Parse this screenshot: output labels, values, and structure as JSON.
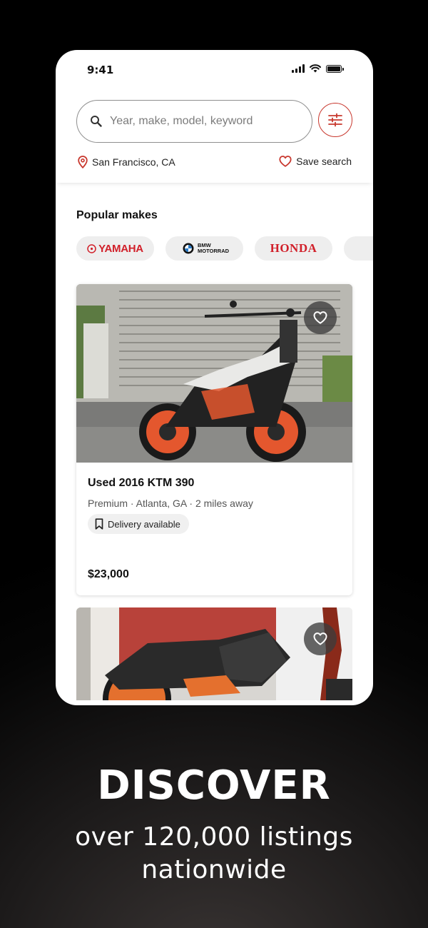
{
  "status_bar": {
    "time": "9:41"
  },
  "search": {
    "placeholder": "Year, make, model, keyword"
  },
  "location": {
    "label": "San Francisco, CA"
  },
  "save_search": {
    "label": "Save search"
  },
  "popular_makes": {
    "title": "Popular makes",
    "items": [
      {
        "logo": "YAMAHA"
      },
      {
        "logo": "BMW MOTORRAD"
      },
      {
        "logo": "HONDA"
      }
    ]
  },
  "listings": [
    {
      "title": "Used 2016 KTM 390",
      "meta": "Premium · Atlanta, GA · 2 miles away",
      "badge": "Delivery available",
      "price": "$23,000"
    }
  ],
  "promo": {
    "headline": "DISCOVER",
    "subline_1": "over 120,000 listings",
    "subline_2": "nationwide"
  },
  "colors": {
    "accent": "#c8372d",
    "brand_red": "#d1202a"
  }
}
